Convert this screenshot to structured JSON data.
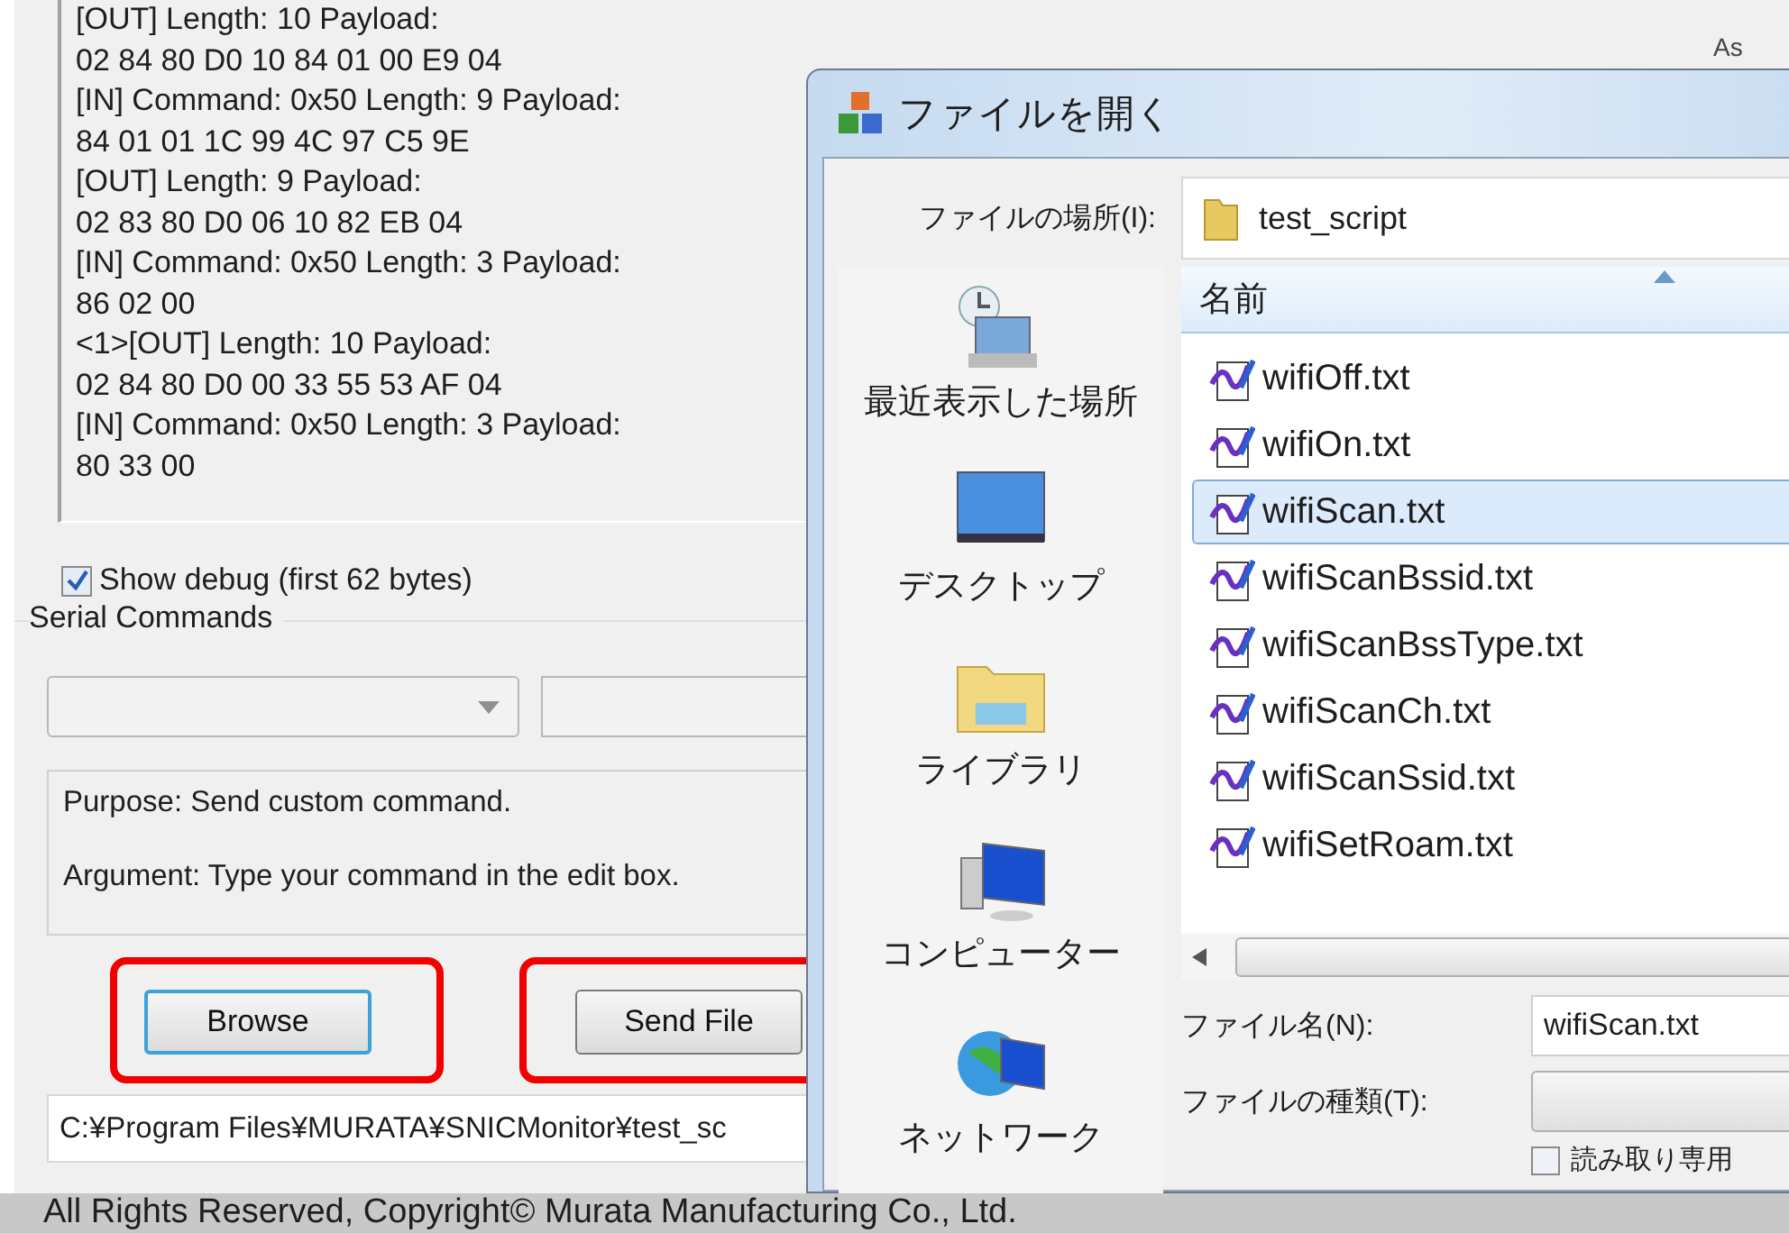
{
  "main_window": {
    "log_lines": [
      "[OUT] Length: 10 Payload:",
      "02 84 80 D0 10 84 01 00 E9 04",
      "[IN] Command: 0x50 Length: 9 Payload:",
      "84 01 01 1C 99 4C 97 C5 9E",
      "[OUT] Length: 9 Payload:",
      "02 83 80 D0 06 10 82 EB 04",
      "[IN] Command: 0x50 Length: 3 Payload:",
      "86 02 00",
      "<1>[OUT] Length: 10 Payload:",
      "02 84 80 D0 00 33 55 53 AF 04",
      "[IN] Command: 0x50 Length: 3 Payload:",
      "80 33 00"
    ],
    "show_debug": {
      "label": "Show debug (first 62 bytes)",
      "checked": true
    },
    "serial_commands": {
      "title": "Serial Commands",
      "description": [
        "Purpose: Send custom command.",
        "Argument: Type your command in the edit box."
      ],
      "buttons": [
        {
          "label": "Browse",
          "focused": true,
          "highlighted": true
        },
        {
          "label": "Send File",
          "focused": false,
          "highlighted": true
        }
      ],
      "path": "C:¥Program Files¥MURATA¥SNICMonitor¥test_sc"
    },
    "footer": "All Rights Reserved, Copyright© Murata Manufacturing Co., Ltd."
  },
  "background_label": "As",
  "dialog": {
    "title": "ファイルを開く",
    "location_label": "ファイルの場所(I):",
    "location": "test_script",
    "places": [
      {
        "label": "最近表示した場所",
        "kind": "recent"
      },
      {
        "label": "デスクトップ",
        "kind": "desktop"
      },
      {
        "label": "ライブラリ",
        "kind": "library"
      },
      {
        "label": "コンピューター",
        "kind": "computer"
      },
      {
        "label": "ネットワーク",
        "kind": "network"
      }
    ],
    "column": "名前",
    "files": [
      {
        "name": "wifiOff.txt",
        "selected": false
      },
      {
        "name": "wifiOn.txt",
        "selected": false
      },
      {
        "name": "wifiScan.txt",
        "selected": true
      },
      {
        "name": "wifiScanBssid.txt",
        "selected": false
      },
      {
        "name": "wifiScanBssType.txt",
        "selected": false
      },
      {
        "name": "wifiScanCh.txt",
        "selected": false
      },
      {
        "name": "wifiScanSsid.txt",
        "selected": false
      },
      {
        "name": "wifiSetRoam.txt",
        "selected": false
      }
    ],
    "filename_label": "ファイル名(N):",
    "filename": "wifiScan.txt",
    "filetype_label": "ファイルの種類(T):",
    "readonly": {
      "label": "読み取り専用",
      "checked": false
    }
  }
}
